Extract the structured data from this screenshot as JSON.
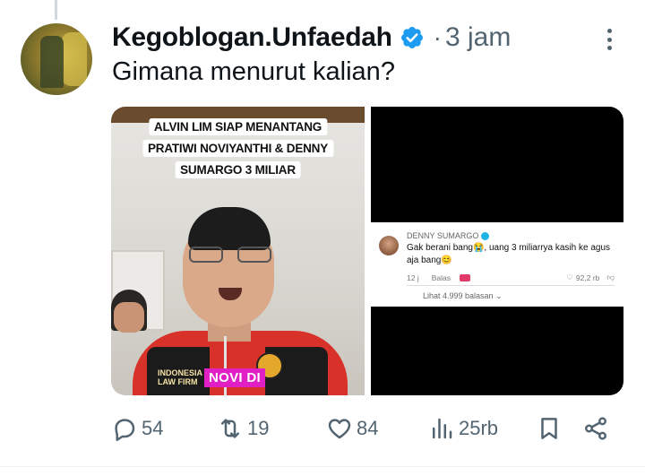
{
  "tweet": {
    "author": {
      "display_name": "Kegoblogan.Unfaedah",
      "verified": true,
      "avatar_icon": "avatar-image"
    },
    "separator": "·",
    "time": "3 jam",
    "text": "Gimana menurut kalian?"
  },
  "media": {
    "left": {
      "caption_lines": [
        "ALVIN LIM SIAP MENANTANG",
        "PRATIWI NOVIYANTHI & DENNY",
        "SUMARGO 3 MILIAR"
      ],
      "subtitle": "NOVI DI",
      "shirt_text": [
        "INDONESIA",
        "LAW FIRM"
      ]
    },
    "right": {
      "comment": {
        "name": "DENNY SUMARGO",
        "text": "Gak berani bang😭, uang 3 miliarrya kasih ke agus aja bang😊",
        "time": "12 j",
        "reply_label": "Balas",
        "likes": "92,2 rb",
        "view_replies": "Lihat 4.999 balasan ⌄"
      }
    }
  },
  "actions": {
    "replies": "54",
    "retweets": "19",
    "likes": "84",
    "views": "25rb"
  },
  "colors": {
    "muted": "#536471",
    "verified": "#1d9bf0",
    "text": "#0f1419"
  }
}
